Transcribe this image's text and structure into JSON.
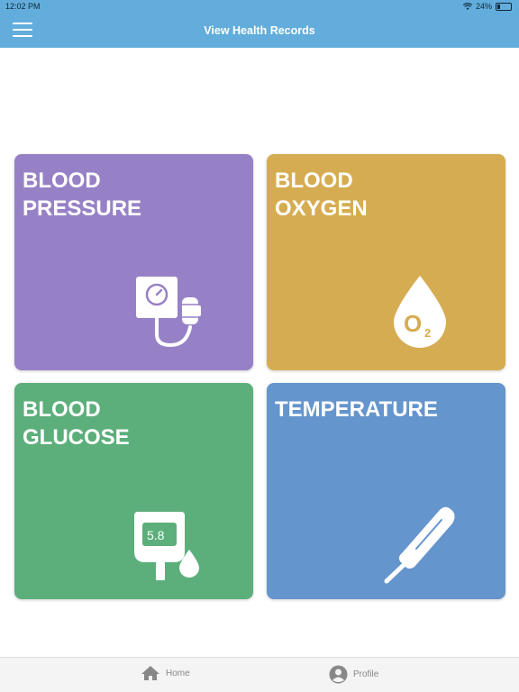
{
  "status": {
    "time": "12:02 PM",
    "battery": "24%",
    "battery_level": 0.24
  },
  "header": {
    "title": "View Health Records"
  },
  "icons": {
    "menu": "hamburger-menu-icon",
    "wifi": "wifi-icon",
    "battery": "battery-icon",
    "home": "home-icon",
    "profile": "profile-icon"
  },
  "tiles": [
    {
      "label": "BLOOD\nPRESSURE",
      "color": "#9781C6",
      "icon": "blood-pressure-monitor-icon"
    },
    {
      "label": "BLOOD\nOXYGEN",
      "color": "#D6AC52",
      "icon": "oxygen-drop-icon",
      "icon_text": "O2"
    },
    {
      "label": "BLOOD\nGLUCOSE",
      "color": "#5CAF7B",
      "icon": "glucose-meter-icon",
      "icon_text": "5.8"
    },
    {
      "label": "TEMPERATURE",
      "color": "#6495CD",
      "icon": "thermometer-icon"
    }
  ],
  "tabbar": {
    "home": "Home",
    "profile": "Profile"
  }
}
